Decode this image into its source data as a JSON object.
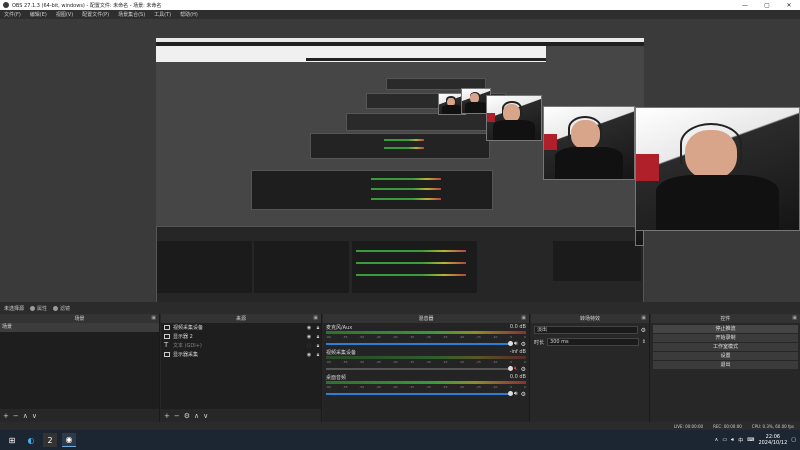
{
  "window": {
    "title": "OBS 27.1.3 (64-bit, windows) - 配置文件: 未命名 - 场景: 未命名",
    "minimize": "—",
    "maximize": "▢",
    "close": "✕"
  },
  "menu": [
    "文件(F)",
    "编辑(E)",
    "视图(V)",
    "配置文件(P)",
    "场景集合(S)",
    "工具(T)",
    "帮助(H)"
  ],
  "status_strip": {
    "no_source": "未选择源",
    "properties": "属性",
    "filters": "滤镜"
  },
  "docks": {
    "scenes": {
      "title": "场景",
      "items": [
        "场景"
      ],
      "footer": [
        "+",
        "−",
        "∧",
        "∨"
      ]
    },
    "sources": {
      "title": "来源",
      "items": [
        {
          "label": "视频采集设备",
          "icon": "camera-icon"
        },
        {
          "label": "显示器 2",
          "icon": "monitor-icon"
        },
        {
          "label": "文本 (GDI+)",
          "icon": "text-icon"
        },
        {
          "label": "显示器采集",
          "icon": "monitor-icon"
        }
      ],
      "footer": [
        "+",
        "−",
        "⚙",
        "∧",
        "∨"
      ]
    },
    "mixer": {
      "title": "混音器",
      "channels": [
        {
          "name": "麦克风/Aux",
          "level": "0.0 dB",
          "muted": false
        },
        {
          "name": "视频采集设备",
          "level": "-inf dB",
          "muted": true
        },
        {
          "name": "桌面音频",
          "level": "0.0 dB",
          "muted": false
        }
      ],
      "scale": [
        "-60",
        "-55",
        "-50",
        "-45",
        "-40",
        "-35",
        "-30",
        "-25",
        "-20",
        "-15",
        "-10",
        "-5",
        "0"
      ]
    },
    "transitions": {
      "title": "转场特效",
      "selected": "淡出",
      "duration_label": "时长",
      "duration": "300 ms"
    },
    "controls": {
      "title": "控件",
      "buttons": [
        "停止推流",
        "开始录制",
        "工作室模式",
        "设置",
        "退出"
      ]
    }
  },
  "obs_status": {
    "live": "LIVE: 00:00:00",
    "rec": "REC: 00:00:00",
    "cpu": "CPU: 0.3%, 60.00 fps"
  },
  "taskbar": {
    "time": "22:06",
    "date": "2024/10/12",
    "lang": "中",
    "icons": [
      "windows-start-icon",
      "edge-icon",
      "xiaomi-icon",
      "obs-icon"
    ]
  },
  "colors": {
    "accent_blue": "#2a7fd6",
    "meter_green": "#3a9b3a",
    "meter_yellow": "#b9b23a",
    "meter_red": "#b84242",
    "mute_red": "#e04040"
  }
}
